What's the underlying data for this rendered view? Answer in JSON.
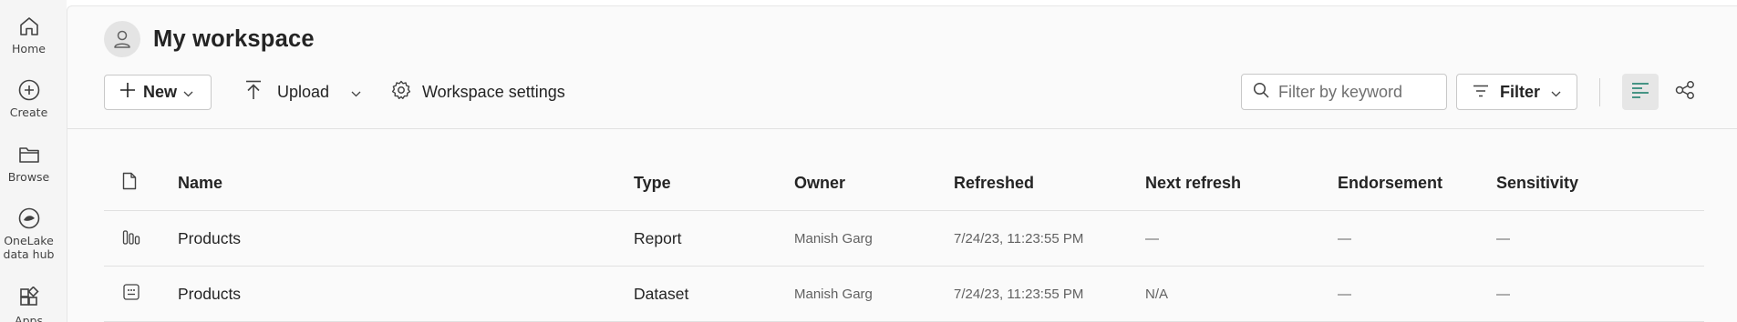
{
  "rail": {
    "items": [
      {
        "label": "Home",
        "icon": "home-icon"
      },
      {
        "label": "Create",
        "icon": "create-icon"
      },
      {
        "label": "Browse",
        "icon": "browse-icon"
      },
      {
        "label": "OneLake data hub",
        "line1": "OneLake",
        "line2": "data hub",
        "icon": "onelake-icon"
      },
      {
        "label": "Apps",
        "icon": "apps-icon"
      }
    ]
  },
  "workspace": {
    "title": "My workspace"
  },
  "toolbar": {
    "new_label": "New",
    "upload_label": "Upload",
    "settings_label": "Workspace settings",
    "search_placeholder": "Filter by keyword",
    "filter_label": "Filter"
  },
  "table": {
    "columns": {
      "name": "Name",
      "type": "Type",
      "owner": "Owner",
      "refreshed": "Refreshed",
      "next_refresh": "Next refresh",
      "endorsement": "Endorsement",
      "sensitivity": "Sensitivity"
    },
    "rows": [
      {
        "icon": "report-icon",
        "name": "Products",
        "type": "Report",
        "owner": "Manish Garg",
        "refreshed": "7/24/23, 11:23:55 PM",
        "next_refresh": "—",
        "endorsement": "—",
        "sensitivity": "—"
      },
      {
        "icon": "dataset-icon",
        "name": "Products",
        "type": "Dataset",
        "owner": "Manish Garg",
        "refreshed": "7/24/23, 11:23:55 PM",
        "next_refresh": "N/A",
        "endorsement": "—",
        "sensitivity": "—"
      }
    ]
  },
  "colors": {
    "rail_bg": "#f5f5f5",
    "main_bg": "#fafafa",
    "accent": "#117865"
  }
}
